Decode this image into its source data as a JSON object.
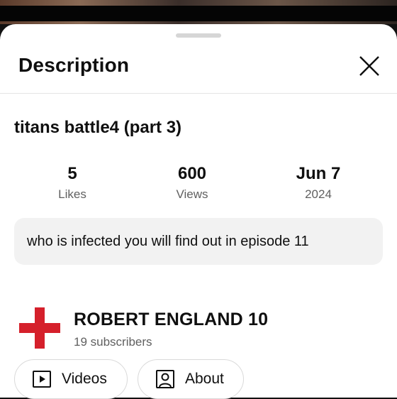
{
  "sheet": {
    "title": "Description",
    "close_icon": "close-icon"
  },
  "video": {
    "title": "titans battle4 (part 3)",
    "stats": {
      "likes": {
        "value": "5",
        "label": "Likes"
      },
      "views": {
        "value": "600",
        "label": "Views"
      },
      "date": {
        "value": "Jun 7",
        "label": "2024"
      }
    },
    "description": "who is infected you will find out in episode 11"
  },
  "channel": {
    "name": "ROBERT ENGLAND 10",
    "subscribers": "19 subscribers",
    "avatar_icon": "red-cross-flag-icon",
    "avatar_color": "#d5202b"
  },
  "buttons": {
    "videos": {
      "label": "Videos",
      "icon": "play-box-icon"
    },
    "about": {
      "label": "About",
      "icon": "person-box-icon"
    }
  }
}
